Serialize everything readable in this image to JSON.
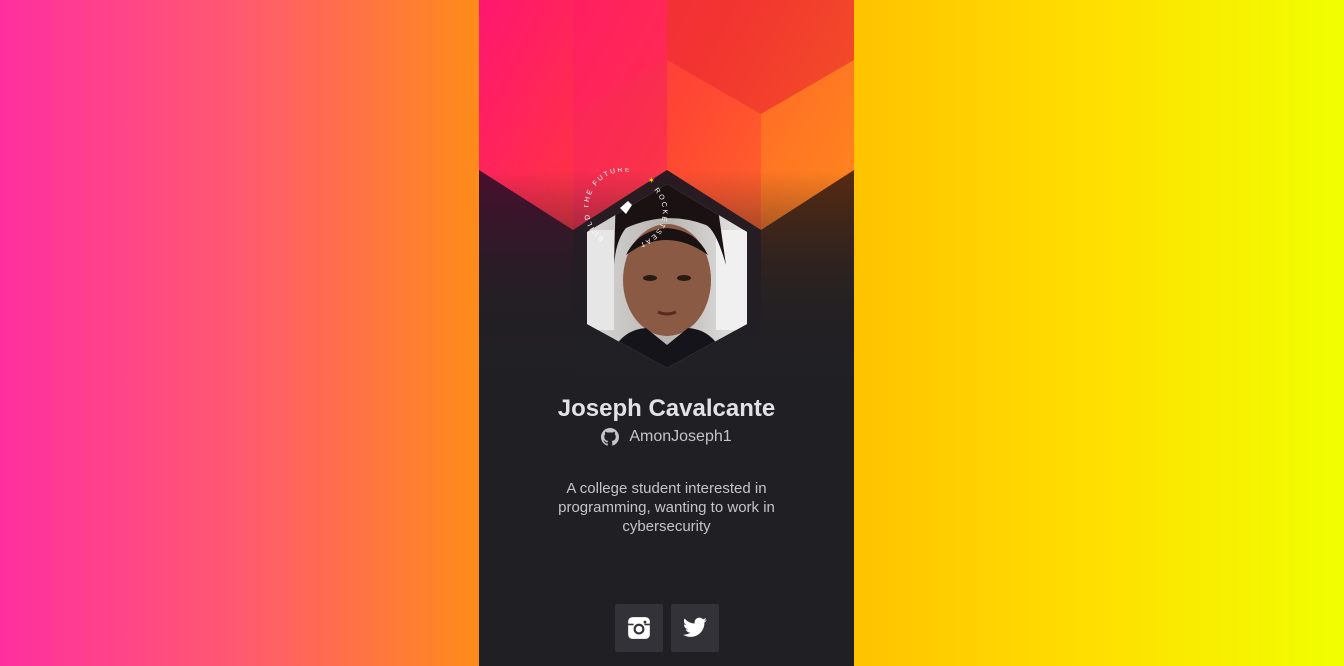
{
  "profile": {
    "name": "Joseph Cavalcante",
    "github_handle": "AmonJoseph1",
    "bio": "A college student interested in programming, wanting to work in cybersecurity",
    "badge_text_left": "BUILD THE FUTURE",
    "badge_text_right": "ROCKETSEAT"
  },
  "socials": [
    {
      "name": "instagram",
      "icon": "instagram-icon"
    },
    {
      "name": "twitter",
      "icon": "twitter-icon"
    }
  ],
  "colors": {
    "card_bg": "#202024",
    "text_primary": "#e1e1e6",
    "text_secondary": "#c4c4cc",
    "button_bg": "#323238"
  }
}
